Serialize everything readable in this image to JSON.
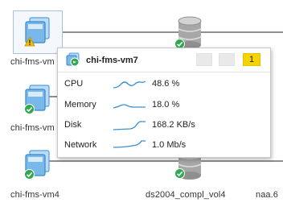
{
  "nodes": {
    "vm_top": {
      "label": "chi-fms-vm",
      "status": "warning"
    },
    "vm_mid": {
      "label": "chi-fms-vm",
      "status": "ok"
    },
    "vm_bottom": {
      "label": "chi-fms-vm4",
      "status": "ok"
    },
    "datastore_top": {
      "label": "",
      "status": "ok"
    },
    "datastore_bottom": {
      "label": "ds2004_compl_vol4",
      "status": "ok"
    },
    "network_label": "naa.6"
  },
  "tooltip": {
    "title": "chi-fms-vm7",
    "alarm_count": "1",
    "metrics": [
      {
        "name": "CPU",
        "value": "48.6 %",
        "trend": "wave"
      },
      {
        "name": "Memory",
        "value": "18.0 %",
        "trend": "flat"
      },
      {
        "name": "Disk",
        "value": "168.2 KB/s",
        "trend": "rising"
      },
      {
        "name": "Network",
        "value": "1.0 Mb/s",
        "trend": "rising"
      }
    ]
  },
  "colors": {
    "vm_icon": "#4d9fe0",
    "ok_badge": "#2fa84f",
    "warning_badge": "#f2c200",
    "alarm_badge": "#f6d200",
    "sparkline": "#3a8fd6",
    "connector": "#8f8f8f"
  }
}
